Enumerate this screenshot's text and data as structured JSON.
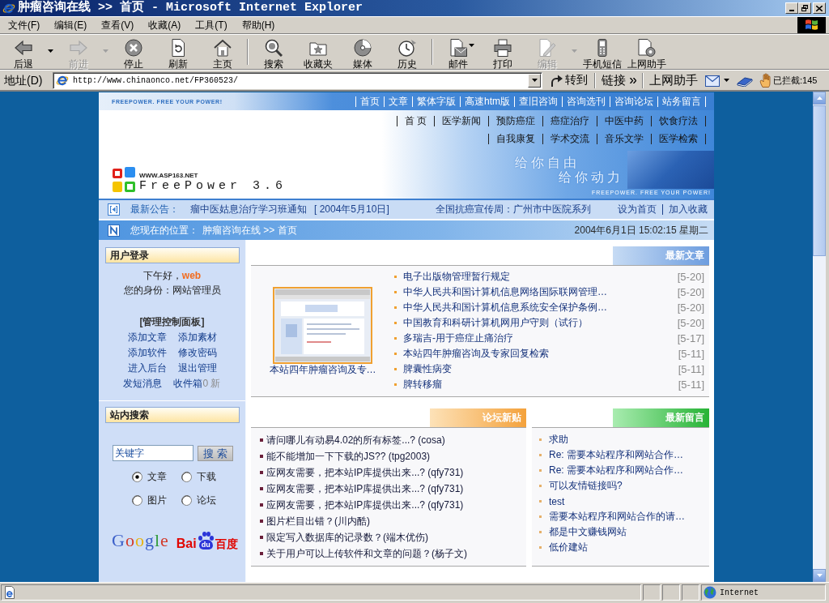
{
  "window": {
    "title": "肿瘤咨询在线 >> 首页 - Microsoft Internet Explorer"
  },
  "menu": [
    "文件(F)",
    "编辑(E)",
    "查看(V)",
    "收藏(A)",
    "工具(T)",
    "帮助(H)"
  ],
  "toolbar": [
    [
      {
        "label": "后退",
        "disabled": false,
        "kind": "split"
      },
      {
        "label": "前进",
        "disabled": true,
        "kind": "split"
      },
      {
        "label": "停止",
        "disabled": false,
        "kind": "plain"
      },
      {
        "label": "刷新",
        "disabled": false,
        "kind": "plain"
      },
      {
        "label": "主页",
        "disabled": false,
        "kind": "plain"
      }
    ],
    [
      {
        "label": "搜索",
        "disabled": false,
        "kind": "plain"
      },
      {
        "label": "收藏夹",
        "disabled": false,
        "kind": "plain"
      },
      {
        "label": "媒体",
        "disabled": false,
        "kind": "plain"
      },
      {
        "label": "历史",
        "disabled": false,
        "kind": "plain"
      }
    ],
    [
      {
        "label": "邮件",
        "disabled": false,
        "kind": "menu"
      },
      {
        "label": "打印",
        "disabled": false,
        "kind": "plain"
      },
      {
        "label": "编辑",
        "disabled": true,
        "kind": "split"
      },
      {
        "label": "手机短信",
        "disabled": false,
        "kind": "plain"
      },
      {
        "label": "上网助手",
        "disabled": false,
        "kind": "plain"
      }
    ]
  ],
  "address_bar": {
    "label": "地址(D)",
    "url": "http://www.chinaonco.net/FP360523/",
    "go": "转到",
    "links": "链接",
    "helper": "上网助手",
    "blocked": "已拦截:145"
  },
  "banner": {
    "slogan": "FREEPOWER. FREE YOUR POWER!",
    "top_links": [
      "首页",
      "文章",
      "繁体字版",
      "高速htm版",
      "查旧咨询",
      "咨询选刊",
      "咨询论坛",
      "站务留言"
    ],
    "nav_rows": [
      [
        "首 页",
        "医学新闻",
        "预防癌症",
        "癌症治疗",
        "中医中药",
        "饮食疗法"
      ],
      [
        "自我康复",
        "学术交流",
        "音乐文学",
        "医学检索"
      ]
    ],
    "logo_site": "WWW.ASP163.NET",
    "logo_name": "FreePower 3.6",
    "motto": [
      "给你自由",
      "给你动力"
    ],
    "slogan_bottom": "FREEPOWER. FREE YOUR POWER!"
  },
  "notice": {
    "label": "最新公告：",
    "title": "瘤中医姑息治疗学习班通知",
    "date": "[ 2004年5月10日]",
    "promo": "全国抗癌宣传周：广州市中医院系列",
    "links": [
      "设为首页",
      "加入收藏"
    ]
  },
  "location": {
    "label": "您现在的位置：",
    "path": "肿瘤咨询在线 >> 首页",
    "datetime": "2004年6月1日 15:02:15 星期二"
  },
  "login": {
    "title": "用户登录",
    "greeting": "下午好，**web**",
    "identity": "您的身份：网站管理员",
    "panel_title": "[管理控制面板]",
    "links": [
      {
        "label": "添加文章"
      },
      {
        "label": "添加素材"
      },
      {
        "label": "添加软件"
      },
      {
        "label": "修改密码"
      },
      {
        "label": "进入后台"
      },
      {
        "label": "退出管理"
      },
      {
        "label": "发短消息"
      },
      {
        "label": "收件箱",
        "count": "0 新"
      }
    ]
  },
  "site_search": {
    "title": "站内搜索",
    "value": "关键字",
    "button": "搜 索",
    "options": [
      {
        "label": "文章",
        "selected": true
      },
      {
        "label": "下载",
        "selected": false
      },
      {
        "label": "图片",
        "selected": false
      },
      {
        "label": "论坛",
        "selected": false
      }
    ]
  },
  "search_logos": {
    "google": "Google",
    "baidu": "Bai",
    "baidu_paw": "du",
    "baidu_cn": "百度"
  },
  "latest_articles": {
    "title": "最新文章",
    "thumbnail_caption": "本站四年肿瘤咨询及专…",
    "items": [
      {
        "title": "电子出版物管理暂行规定",
        "date": "[5-20]"
      },
      {
        "title": "中华人民共和国计算机信息网络国际联网管理…",
        "date": "[5-20]"
      },
      {
        "title": "中华人民共和国计算机信息系统安全保护条例…",
        "date": "[5-20]"
      },
      {
        "title": "中国教育和科研计算机网用户守则（试行）",
        "date": "[5-20]"
      },
      {
        "title": "多瑞吉-用于癌症止痛治疗",
        "date": "[5-17]"
      },
      {
        "title": "本站四年肿瘤咨询及专家回复检索",
        "date": "[5-11]"
      },
      {
        "title": "脾囊性病变",
        "date": "[5-11]"
      },
      {
        "title": "脾转移瘤",
        "date": "[5-11]"
      }
    ]
  },
  "forum_posts": {
    "title": "论坛新贴",
    "items": [
      "请问哪儿有动易4.02的所有标签...? (cosa)",
      "能不能增加一下下载的JS?? (tpg2003)",
      "应网友需要，把本站IP库提供出来...? (qfy731)",
      "应网友需要，把本站IP库提供出来...? (qfy731)",
      "应网友需要，把本站IP库提供出来...? (qfy731)",
      "图片栏目出错？(川内酷)",
      "限定写入数据库的记录数？(端木优伤)",
      "关于用户可以上传软件和文章的问题？(杨子文)"
    ]
  },
  "latest_messages": {
    "title": "最新留言",
    "items": [
      "求助",
      "Re: 需要本站程序和网站合作…",
      "Re: 需要本站程序和网站合作…",
      "可以友情链接吗?",
      "test",
      "需要本站程序和网站合作的请…",
      "都是中文赚钱网站",
      "低价建站"
    ]
  },
  "status_bar": {
    "zone": "Internet"
  }
}
